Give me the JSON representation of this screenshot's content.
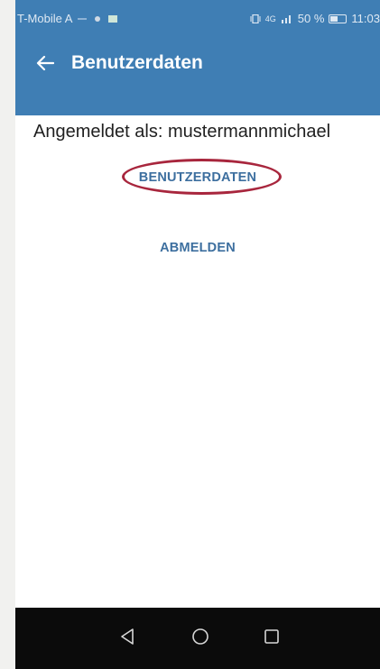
{
  "status_bar": {
    "carrier": "T-Mobile A",
    "network": "4G",
    "battery_text": "50 %",
    "battery_level": 0.5,
    "time": "11:03"
  },
  "app_bar": {
    "title": "Benutzerdaten",
    "back_icon": "arrow-left-icon"
  },
  "main": {
    "logged_in_text": "Angemeldet als: mustermannmichael",
    "userdata_button": "BENUTZERDATEN",
    "logout_button": "ABMELDEN"
  },
  "nav_bar": {
    "back_icon": "triangle-back-icon",
    "home_icon": "circle-home-icon",
    "recents_icon": "square-recents-icon"
  },
  "colors": {
    "app_bar": "#3f7eb4",
    "button_text": "#3d6f9f",
    "highlight": "#a8263d",
    "nav_bar": "#0b0b0b"
  }
}
